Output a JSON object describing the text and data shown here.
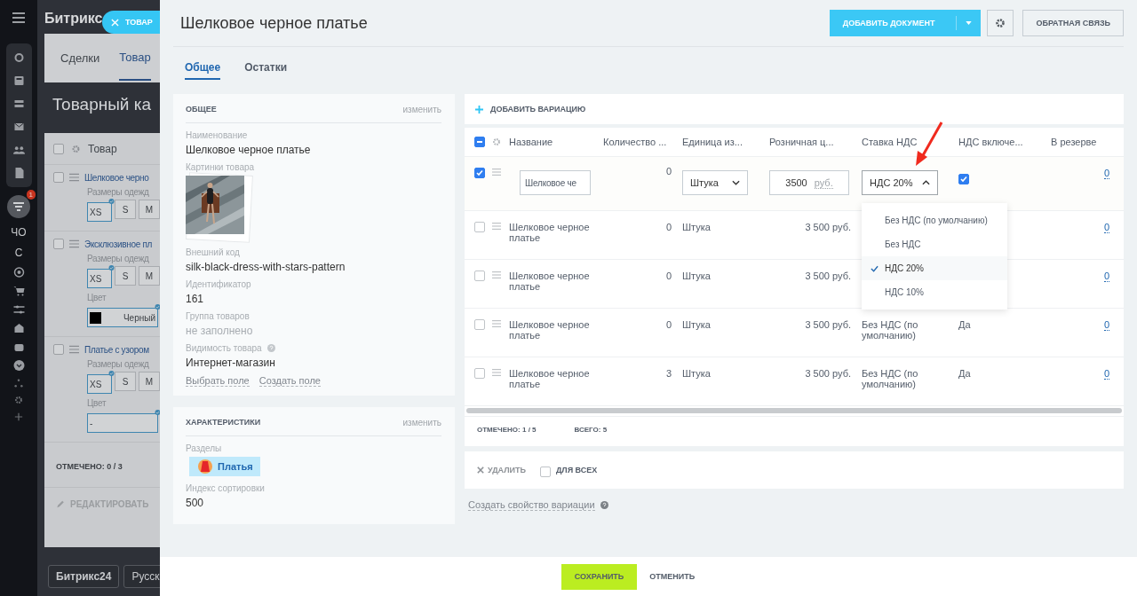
{
  "background": {
    "logo": "Битрикс",
    "sidebar": {
      "badge": "1",
      "labels": [
        "ЧО",
        "С"
      ]
    },
    "close_tag": "ТОВАР",
    "tabs": [
      {
        "label": "Сделки",
        "selected": false
      },
      {
        "label": "Товар",
        "selected": true
      }
    ],
    "page_title": "Товарный ка",
    "grid": {
      "column": "Товар",
      "header_checked": false,
      "rows": [
        {
          "checked": false,
          "name": "Шелковое черно",
          "properties": [
            {
              "label": "Размеры одежд",
              "values": [
                {
                  "label": "XS",
                  "selected": true
                },
                {
                  "label": "S",
                  "selected": false
                },
                {
                  "label": "M",
                  "selected": false
                }
              ]
            }
          ]
        },
        {
          "checked": false,
          "name": "Эксклюзивное пл",
          "properties": [
            {
              "label": "Размеры одежд",
              "values": [
                {
                  "label": "XS",
                  "selected": true
                },
                {
                  "label": "S",
                  "selected": false
                },
                {
                  "label": "M",
                  "selected": false
                }
              ]
            },
            {
              "label": "Цвет",
              "values": [
                {
                  "label": "Черный",
                  "color": "#000000",
                  "selected": true
                }
              ]
            }
          ]
        },
        {
          "checked": false,
          "name": "Платье с узором",
          "properties": [
            {
              "label": "Размеры одежд",
              "values": [
                {
                  "label": "XS",
                  "selected": true
                },
                {
                  "label": "S",
                  "selected": false
                },
                {
                  "label": "M",
                  "selected": false
                }
              ]
            },
            {
              "label": "Цвет",
              "values": [
                {
                  "label": "-",
                  "selected": true
                }
              ]
            }
          ]
        }
      ],
      "summary": "ОТМЕЧЕНО: **0 / 3**",
      "edit": "РЕДАКТИРОВАТЬ"
    },
    "footer": [
      "Битрикс24",
      "Русск"
    ]
  },
  "slider": {
    "title": "Шелковое черное платье",
    "add_document": "ДОБАВИТЬ ДОКУМЕНТ",
    "feedback": "ОБРАТНАЯ СВЯЗЬ",
    "tabs": [
      {
        "label": "Общее",
        "selected": true
      },
      {
        "label": "Остатки",
        "selected": false
      }
    ],
    "cards": [
      {
        "title": "ОБЩЕЕ",
        "action": "изменить",
        "fields": [
          {
            "kind": "text",
            "label": "Наименование",
            "value": "Шелковое черное платье",
            "help": false
          },
          {
            "kind": "picture",
            "label": "Картинки товара",
            "help": false
          },
          {
            "kind": "text",
            "label": "Внешний код",
            "value": "silk-black-dress-with-stars-pattern",
            "help": false
          },
          {
            "kind": "text",
            "label": "Идентификатор",
            "value": "161",
            "help": false
          },
          {
            "kind": "empty",
            "label": "Группа товаров",
            "value": "не заполнено",
            "help": false
          },
          {
            "kind": "text",
            "label": "Видимость товара",
            "value": "Интернет-магазин",
            "help": true
          }
        ],
        "links": [
          "Выбрать поле",
          "Создать поле"
        ]
      },
      {
        "title": "ХАРАКТЕРИСТИКИ",
        "action": "изменить",
        "fields": [
          {
            "kind": "section",
            "label": "Разделы",
            "value": "Платья",
            "help": false
          },
          {
            "kind": "text",
            "label": "Индекс сортировки",
            "value": "500",
            "help": false
          }
        ]
      }
    ],
    "variations": {
      "add": "ДОБАВИТЬ ВАРИАЦИЮ",
      "header_partial": true,
      "columns": [
        "Название",
        "Количество ...",
        "Единица из...",
        "Розничная ц...",
        "Ставка НДС",
        "НДС включе...",
        "В резерве"
      ],
      "rows": [
        {
          "kind": "edit",
          "selected": true,
          "name": "Шелковое че",
          "quantity": "0",
          "unit": "Штука",
          "price": "3500",
          "currency": "руб.",
          "vat": "НДС 20%",
          "vat_included": true,
          "reserve": "0"
        },
        {
          "kind": "view",
          "selected": false,
          "name": "Шелковое черное платье",
          "quantity": "0",
          "unit": "Штука",
          "price": "3 500 руб.",
          "reserve": "0"
        },
        {
          "kind": "view",
          "selected": false,
          "name": "Шелковое черное платье",
          "quantity": "0",
          "unit": "Штука",
          "price": "3 500 руб.",
          "reserve": "0"
        },
        {
          "kind": "view",
          "selected": false,
          "name": "Шелковое черное платье",
          "quantity": "0",
          "unit": "Штука",
          "price": "3 500 руб.",
          "vat": "Без НДС (по умолчанию)",
          "vat_text": "Да",
          "reserve": "0"
        },
        {
          "kind": "view",
          "selected": false,
          "name": "Шелковое черное платье",
          "quantity": "3",
          "unit": "Штука",
          "price": "3 500 руб.",
          "vat": "Без НДС (по умолчанию)",
          "vat_text": "Да",
          "reserve": "0"
        }
      ],
      "dropdown": [
        {
          "label": "Без НДС (по умолчанию)",
          "selected": false
        },
        {
          "label": "Без НДС",
          "selected": false
        },
        {
          "label": "НДС 20%",
          "selected": true
        },
        {
          "label": "НДС 10%",
          "selected": false
        }
      ],
      "summary": "ОТМЕЧЕНО: **1 / 5**",
      "total": "ВСЕГО: **5**",
      "delete": "УДАЛИТЬ",
      "for_all": {
        "label": "ДЛЯ ВСЕХ",
        "checked": false
      },
      "create_property": "Создать свойство вариации"
    },
    "save": "СОХРАНИТЬ",
    "cancel": "ОТМЕНИТЬ"
  }
}
